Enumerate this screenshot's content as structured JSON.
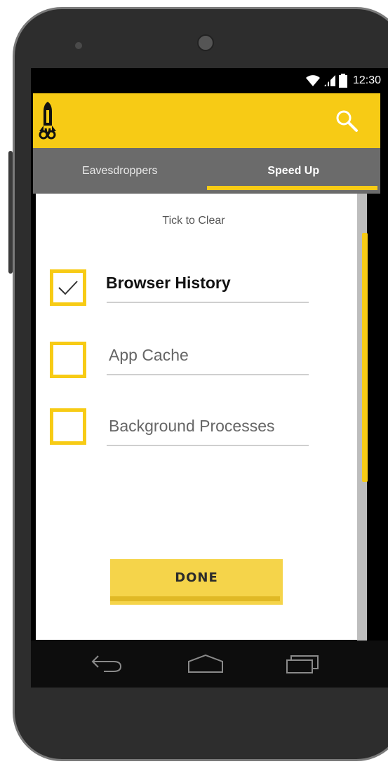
{
  "status_bar": {
    "time": "12:30",
    "icons": [
      "wifi-icon",
      "cell-signal-icon",
      "battery-icon"
    ]
  },
  "toolbar": {
    "logo_icon": "rocket-logo-icon",
    "search_icon": "search-icon"
  },
  "tabs": [
    {
      "label": "Eavesdroppers",
      "active": false
    },
    {
      "label": "Speed Up",
      "active": true
    }
  ],
  "content": {
    "instruction": "Tick to Clear",
    "items": [
      {
        "label": "Browser History",
        "checked": true
      },
      {
        "label": "App Cache",
        "checked": false
      },
      {
        "label": "Background Processes",
        "checked": false
      }
    ],
    "done_label": "DONE"
  },
  "nav_bar": {
    "icons": [
      "back-icon",
      "home-icon",
      "recents-icon"
    ]
  },
  "colors": {
    "accent": "#f7cb15",
    "tab_bar": "#6b6b6b",
    "done_button": "#f5d44a"
  }
}
